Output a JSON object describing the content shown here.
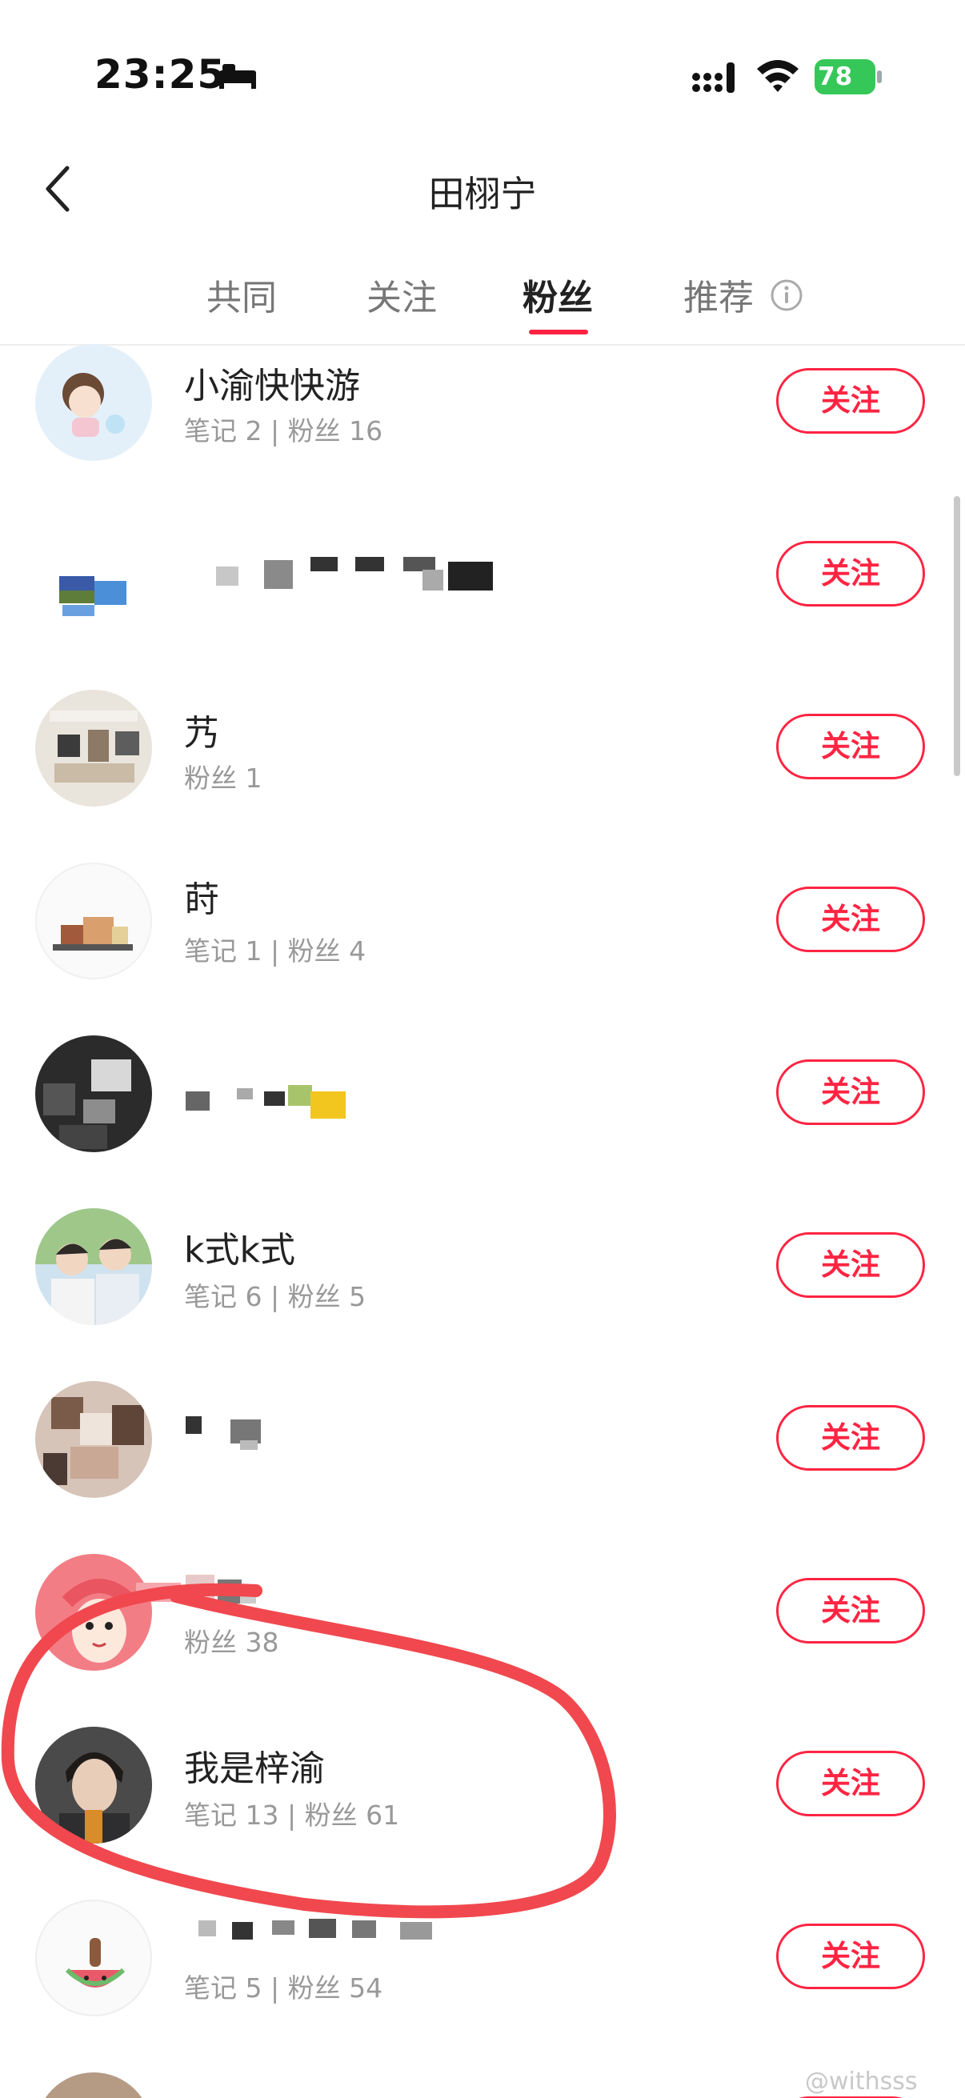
{
  "status": {
    "time": "23:25",
    "battery": "78"
  },
  "header": {
    "title": "田栩宁"
  },
  "tabs": [
    {
      "label": "共同"
    },
    {
      "label": "关注"
    },
    {
      "label": "粉丝"
    },
    {
      "label": "推荐"
    }
  ],
  "active_tab": "粉丝",
  "users": [
    {
      "name": "小渝快快游",
      "stats": "笔记 2 | 粉丝 16",
      "button": "关注"
    },
    {
      "name": "",
      "stats": "",
      "button": "关注"
    },
    {
      "name": "艿",
      "stats": "粉丝 1",
      "button": "关注"
    },
    {
      "name": "莳",
      "stats": "笔记 1 | 粉丝 4",
      "button": "关注"
    },
    {
      "name": "",
      "stats": "",
      "button": "关注"
    },
    {
      "name": "k式k式",
      "stats": "笔记 6 | 粉丝 5",
      "button": "关注"
    },
    {
      "name": "",
      "stats": "",
      "button": "关注"
    },
    {
      "name": "",
      "stats": "粉丝 38",
      "button": "关注"
    },
    {
      "name": "我是梓渝",
      "stats": "笔记 13 | 粉丝 61",
      "button": "关注"
    },
    {
      "name": "",
      "stats": "笔记 5 | 粉丝 54",
      "button": "关注"
    }
  ],
  "watermark": "@withsss",
  "colors": {
    "accent": "#ff2442",
    "battery": "#36c759",
    "annotation": "#f0484e"
  }
}
